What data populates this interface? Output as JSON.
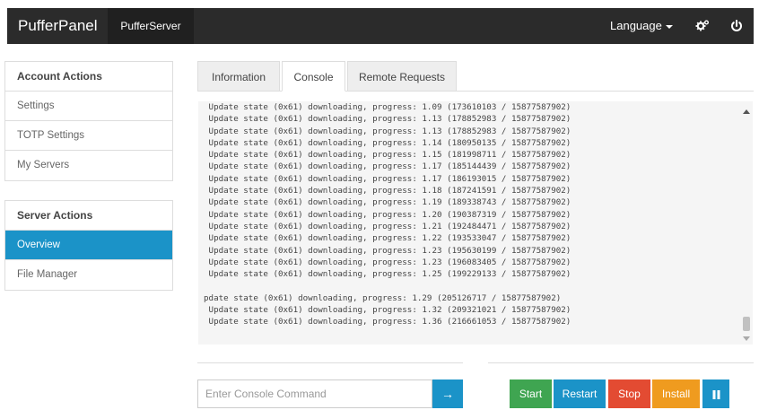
{
  "navbar": {
    "brand": "PufferPanel",
    "server_name": "PufferServer",
    "language_label": "Language"
  },
  "account_actions": {
    "title": "Account Actions",
    "items": [
      "Settings",
      "TOTP Settings",
      "My Servers"
    ]
  },
  "server_actions": {
    "title": "Server Actions",
    "items": [
      "Overview",
      "File Manager"
    ],
    "active": "Overview"
  },
  "tabs": {
    "items": [
      "Information",
      "Console",
      "Remote Requests"
    ],
    "active": "Console"
  },
  "console": {
    "lines": [
      " Update state (0x61) downloading, progress: 1.09 (173610103 / 15877587902)",
      " Update state (0x61) downloading, progress: 1.13 (178852983 / 15877587902)",
      " Update state (0x61) downloading, progress: 1.13 (178852983 / 15877587902)",
      " Update state (0x61) downloading, progress: 1.14 (180950135 / 15877587902)",
      " Update state (0x61) downloading, progress: 1.15 (181998711 / 15877587902)",
      " Update state (0x61) downloading, progress: 1.17 (185144439 / 15877587902)",
      " Update state (0x61) downloading, progress: 1.17 (186193015 / 15877587902)",
      " Update state (0x61) downloading, progress: 1.18 (187241591 / 15877587902)",
      " Update state (0x61) downloading, progress: 1.19 (189338743 / 15877587902)",
      " Update state (0x61) downloading, progress: 1.20 (190387319 / 15877587902)",
      " Update state (0x61) downloading, progress: 1.21 (192484471 / 15877587902)",
      " Update state (0x61) downloading, progress: 1.22 (193533047 / 15877587902)",
      " Update state (0x61) downloading, progress: 1.23 (195630199 / 15877587902)",
      " Update state (0x61) downloading, progress: 1.23 (196083405 / 15877587902)",
      " Update state (0x61) downloading, progress: 1.25 (199229133 / 15877587902)",
      "",
      "pdate state (0x61) downloading, progress: 1.29 (205126717 / 15877587902)",
      " Update state (0x61) downloading, progress: 1.32 (209321021 / 15877587902)",
      " Update state (0x61) downloading, progress: 1.36 (216661053 / 15877587902)"
    ]
  },
  "command": {
    "placeholder": "Enter Console Command",
    "send_symbol": "→"
  },
  "controls": {
    "start": "Start",
    "restart": "Restart",
    "stop": "Stop",
    "install": "Install"
  },
  "icons": {
    "settings": "cogs-icon",
    "power": "power-icon",
    "pause": "pause-icon"
  },
  "colors": {
    "navbar": "#2b2b2b",
    "primary": "#1b93c8",
    "start": "#3fa551",
    "restart": "#1b93c8",
    "stop": "#e34b32",
    "install": "#ef9b1f"
  }
}
